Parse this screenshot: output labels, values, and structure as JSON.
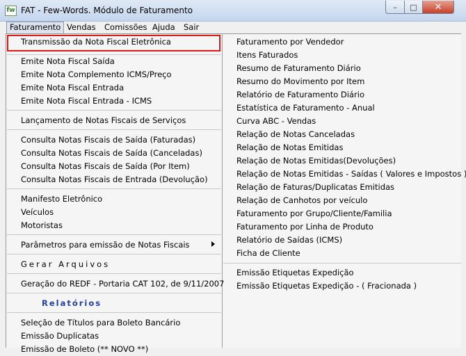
{
  "window": {
    "title": "FAT - Few-Words. Módulo de Faturamento",
    "icon": "app-logo-icon",
    "icon_text": "fw",
    "minimize_symbol": "–",
    "maximize_symbol": "□",
    "close_symbol": "✕"
  },
  "menubar": [
    "Faturamento",
    "Vendas",
    "Comissões",
    "Ajuda",
    "Sair"
  ],
  "left_menu": [
    "Transmissão da Nota Fiscal Eletrônica",
    "Emite Nota Fiscal Saída",
    "Emite Nota Complemento ICMS/Preço",
    "Emite Nota Fiscal Entrada",
    "Emite Nota Fiscal Entrada - ICMS",
    "Lançamento de Notas Fiscais de Serviços",
    "Consulta Notas Fiscais de Saída (Faturadas)",
    "Consulta Notas Fiscais de Saída (Canceladas)",
    "Consulta Notas Fiscais de Saída (Por Item)",
    "Consulta Notas Fiscais de Entrada (Devolução)",
    "Manifesto Eletrônico",
    "Veículos",
    "Motoristas",
    "Parâmetros para emissão de Notas Fiscais",
    "Gerar Arquivos",
    "Geração do REDF - Portaria CAT 102, de 9/11/2007",
    "Relatórios",
    "Seleção de Títulos para Boleto Bancário",
    "Emissão Duplicatas",
    "Emissão de Boleto (** NOVO **)"
  ],
  "right_menu": [
    "Faturamento por Vendedor",
    "Itens Faturados",
    "Resumo de Faturamento Diário",
    "Resumo do Movimento por Item",
    "Relatório de Faturamento Diário",
    "Estatística de Faturamento - Anual",
    "Curva ABC - Vendas",
    "Relação de Notas Canceladas",
    "Relação de Notas Emitidas",
    "Relação de Notas Emitidas(Devoluções)",
    "Relação de Notas Emitidas - Saídas ( Valores e Impostos )",
    "Relação de Faturas/Duplicatas Emitidas",
    "Relação de Canhotos por veículo",
    "Faturamento por Grupo/Cliente/Familia",
    "Faturamento por Linha de Produto",
    "Relatório de  Saídas (ICMS)",
    "Ficha de Cliente",
    "Emissão Etiquetas Expedição",
    "Emissão Etiquetas Expedição - ( Fracionada )"
  ],
  "colors": {
    "highlight_border": "#e01818",
    "heading": "#1f3fa0"
  }
}
